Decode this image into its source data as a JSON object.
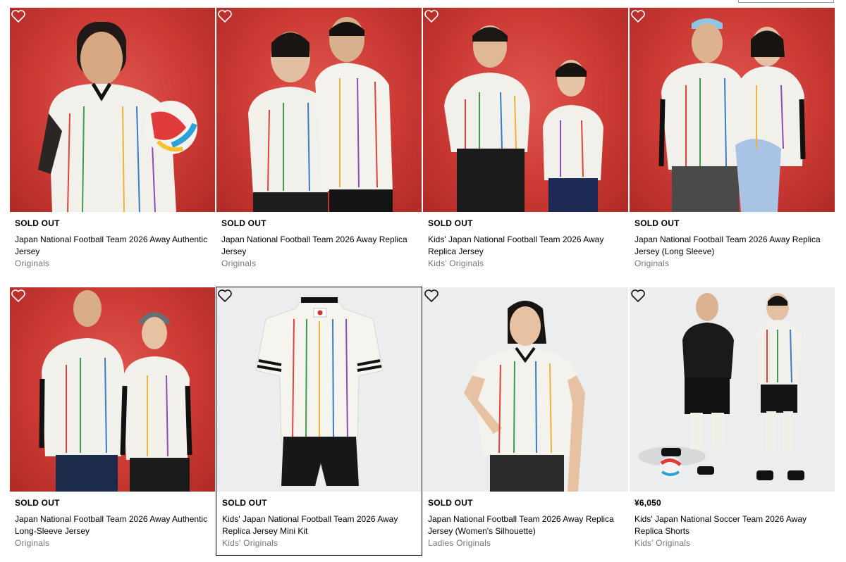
{
  "colors": {
    "red_bg": "#cc3a34",
    "grey_bg": "#ebedee",
    "text": "#000000",
    "muted": "#767677"
  },
  "products": [
    {
      "price": "SOLD OUT",
      "name": "Japan National Football Team 2026 Away Authentic Jersey",
      "category": "Originals",
      "background": "red"
    },
    {
      "price": "SOLD OUT",
      "name": "Japan National Football Team 2026 Away Replica Jersey",
      "category": "Originals",
      "background": "red"
    },
    {
      "price": "SOLD OUT",
      "name": "Kids' Japan National Football Team 2026 Away Replica Jersey",
      "category": "Kids' Originals",
      "background": "red"
    },
    {
      "price": "SOLD OUT",
      "name": "Japan National Football Team 2026 Away Replica Jersey (Long Sleeve)",
      "category": "Originals",
      "background": "red"
    },
    {
      "price": "SOLD OUT",
      "name": "Japan National Football Team 2026 Away Authentic Long-Sleeve Jersey",
      "category": "Originals",
      "background": "red"
    },
    {
      "price": "SOLD OUT",
      "name": "Kids' Japan National Football Team 2026 Away Replica Jersey Mini Kit",
      "category": "Kids' Originals",
      "background": "grey"
    },
    {
      "price": "SOLD OUT",
      "name": "Japan National Football Team 2026 Away Replica Jersey (Women's Silhouette)",
      "category": "Ladies Originals",
      "background": "grey"
    },
    {
      "price": "¥6,050",
      "name": "Kids' Japan National Soccer Team 2026 Away Replica Shorts",
      "category": "Kids' Originals",
      "background": "grey"
    }
  ],
  "icons": {
    "wishlist": "heart-outline-icon"
  }
}
